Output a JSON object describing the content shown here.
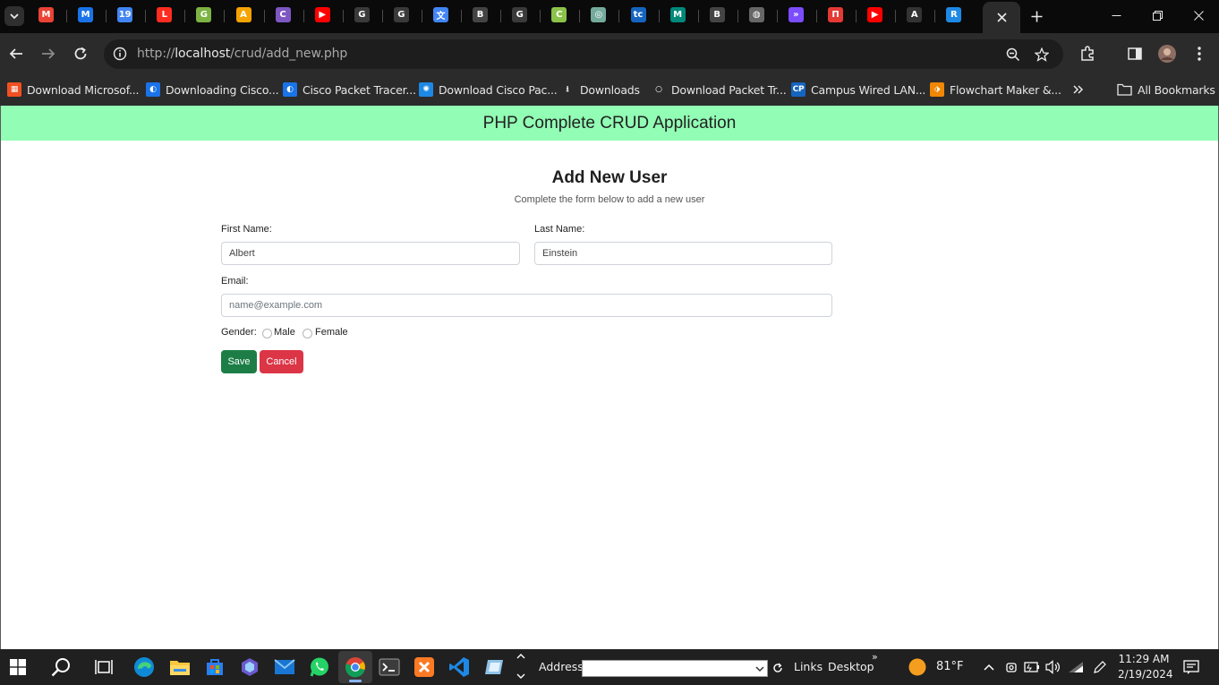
{
  "browser": {
    "url_prefix": "http://",
    "url_host": "localhost",
    "url_path": "/crud/add_new.php",
    "pinned_tabs": [
      {
        "name": "gmail",
        "glyph": "M",
        "color": "#ea4335"
      },
      {
        "name": "mathway",
        "glyph": "M",
        "color": "#1a73e8"
      },
      {
        "name": "calendar",
        "glyph": "19",
        "color": "#4285f4"
      },
      {
        "name": "laravel",
        "glyph": "L",
        "color": "#ff2d20"
      },
      {
        "name": "app-green",
        "glyph": "G",
        "color": "#7cb342"
      },
      {
        "name": "app-orange",
        "glyph": "A",
        "color": "#f4a300"
      },
      {
        "name": "app-purple",
        "glyph": "C",
        "color": "#7e57c2"
      },
      {
        "name": "youtube",
        "glyph": "▶",
        "color": "#ff0000"
      },
      {
        "name": "github",
        "glyph": "G",
        "color": "#3a3a3a"
      },
      {
        "name": "github",
        "glyph": "G",
        "color": "#3a3a3a"
      },
      {
        "name": "translate",
        "glyph": "文",
        "color": "#4285f4"
      },
      {
        "name": "app-bot",
        "glyph": "B",
        "color": "#444"
      },
      {
        "name": "github",
        "glyph": "G",
        "color": "#3a3a3a"
      },
      {
        "name": "app-c",
        "glyph": "C",
        "color": "#8bc34a"
      },
      {
        "name": "chatgpt",
        "glyph": "◎",
        "color": "#74aa9c"
      },
      {
        "name": "tc",
        "glyph": "tc",
        "color": "#1565c0"
      },
      {
        "name": "app-m",
        "glyph": "M",
        "color": "#00897b"
      },
      {
        "name": "app-bot",
        "glyph": "B",
        "color": "#444"
      },
      {
        "name": "globe",
        "glyph": "◍",
        "color": "#666"
      },
      {
        "name": "app-purple2",
        "glyph": "»",
        "color": "#7c4dff"
      },
      {
        "name": "app-red",
        "glyph": "П",
        "color": "#e53935"
      },
      {
        "name": "youtube",
        "glyph": "▶",
        "color": "#ff0000"
      },
      {
        "name": "app-a",
        "glyph": "A",
        "color": "#333"
      },
      {
        "name": "app-r",
        "glyph": "R",
        "color": "#1e88e5"
      }
    ],
    "bookmarks": [
      {
        "label": "Download Microsof...",
        "color": "#f25022",
        "glyph": "▦"
      },
      {
        "label": "Downloading Cisco...",
        "color": "#1a73e8",
        "glyph": "◐"
      },
      {
        "label": "Cisco Packet Tracer...",
        "color": "#1a73e8",
        "glyph": "◐"
      },
      {
        "label": "Download Cisco Pac...",
        "color": "#1e88e5",
        "glyph": "✺"
      },
      {
        "label": "Downloads",
        "color": "#2b2b2b",
        "glyph": "⭳"
      },
      {
        "label": "Download Packet Tr...",
        "color": "#2b2b2b",
        "glyph": "○"
      },
      {
        "label": "Campus Wired LAN...",
        "color": "#1565c0",
        "glyph": "CP"
      },
      {
        "label": "Flowchart Maker &...",
        "color": "#f08705",
        "glyph": "⬗"
      }
    ],
    "all_bookmarks_label": "All Bookmarks"
  },
  "page": {
    "header_title": "PHP Complete CRUD Application",
    "form_title": "Add New User",
    "form_subtitle": "Complete the form below to add a new user",
    "first_name_label": "First Name:",
    "first_name_value": "Albert",
    "last_name_label": "Last Name:",
    "last_name_value": "Einstein",
    "email_label": "Email:",
    "email_placeholder": "name@example.com",
    "gender_label": "Gender:",
    "gender_options": [
      "Male",
      "Female"
    ],
    "save_label": "Save",
    "cancel_label": "Cancel",
    "colors": {
      "header_bg": "#92fdb4",
      "save": "#1c7e46",
      "cancel": "#dc3546"
    }
  },
  "taskbar": {
    "address_label": "Address",
    "links_label": "Links",
    "desktop_label": "Desktop",
    "weather": "81°F",
    "time": "11:29 AM",
    "date": "2/19/2024"
  }
}
